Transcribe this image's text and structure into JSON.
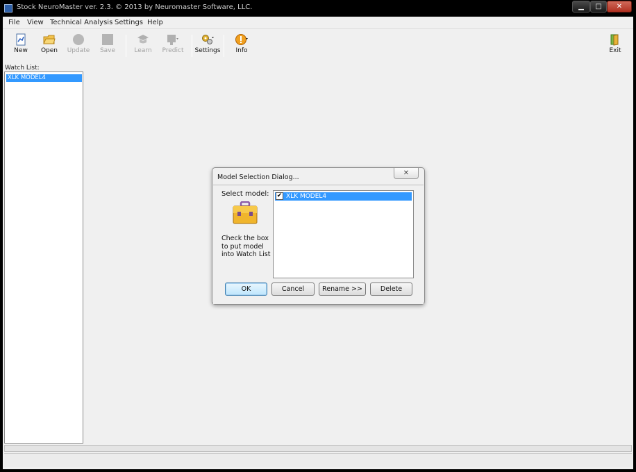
{
  "window": {
    "title": "Stock NeuroMaster ver. 2.3. © 2013 by Neuromaster Software, LLC.",
    "minimize": "▁",
    "maximize": "□",
    "close": "✕"
  },
  "menu": [
    "File",
    "View",
    "Technical Analysis",
    "Settings",
    "Help"
  ],
  "toolbar": {
    "new": "New",
    "open": "Open",
    "update": "Update",
    "save": "Save",
    "learn": "Learn",
    "predict": "Predict",
    "settings": "Settings",
    "info": "Info",
    "exit": "Exit"
  },
  "watch_list": {
    "label": "Watch List:",
    "items": [
      "XLK MODEL4"
    ]
  },
  "dialog": {
    "title": "Model Selection Dialog...",
    "close": "✕",
    "select_label": "Select model:",
    "hint": "Check the box to put model into Watch List",
    "models": [
      {
        "name": "XLK MODEL4",
        "checked": "✔"
      }
    ],
    "buttons": {
      "ok": "OK",
      "cancel": "Cancel",
      "rename": "Rename >>",
      "delete": "Delete"
    }
  },
  "colors": {
    "selection": "#3399ff",
    "background": "#f0f0f0",
    "close_button": "#c0392b"
  }
}
